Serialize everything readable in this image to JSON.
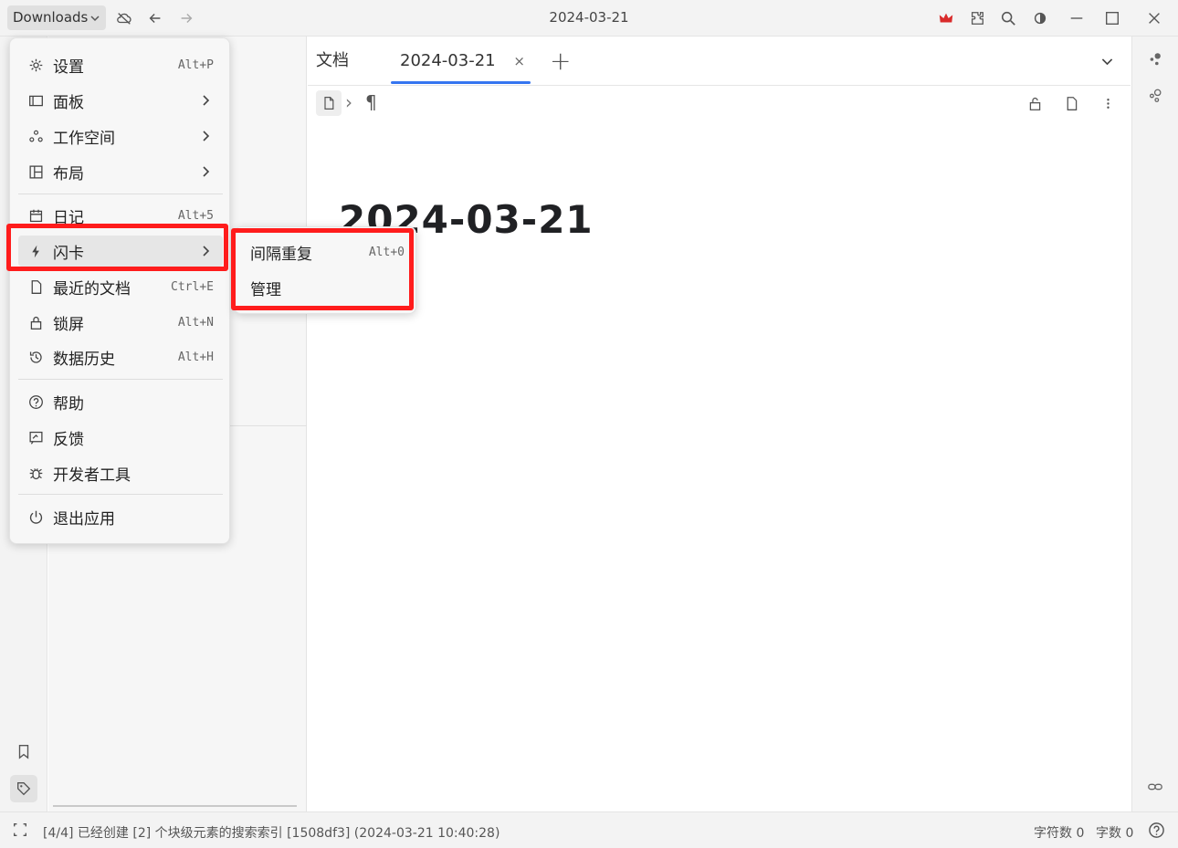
{
  "topbar": {
    "workspace": "Downloads",
    "window_title": "2024-03-21",
    "crown_color": "#d92b2b"
  },
  "editor": {
    "tabs": [
      {
        "label": "文档"
      },
      {
        "label": "2024-03-21",
        "close": "×"
      }
    ],
    "add_tab": "+",
    "crumb_sep": "›",
    "crumb_para": "¶",
    "doc_title": "2024-03-21"
  },
  "menu": {
    "items": [
      {
        "label": "设置",
        "kb": "Alt+P"
      },
      {
        "label": "面板"
      },
      {
        "label": "工作空间"
      },
      {
        "label": "布局"
      },
      {
        "label": "日记",
        "kb": "Alt+5"
      },
      {
        "label": "闪卡"
      },
      {
        "label": "最近的文档",
        "kb": "Ctrl+E"
      },
      {
        "label": "锁屏",
        "kb": "Alt+N"
      },
      {
        "label": "数据历史",
        "kb": "Alt+H"
      },
      {
        "label": "帮助"
      },
      {
        "label": "反馈"
      },
      {
        "label": "开发者工具"
      },
      {
        "label": "退出应用"
      }
    ]
  },
  "submenu": {
    "items": [
      {
        "label": "间隔重复",
        "kb": "Alt+0"
      },
      {
        "label": "管理"
      }
    ]
  },
  "statusbar": {
    "message": "[4/4] 已经创建 [2] 个块级元素的搜索索引 [1508df3] (2024-03-21 10:40:28)",
    "char_count": "字符数 0",
    "word_count": "字数 0"
  },
  "highlight_color": "#ff1c1c",
  "accent_color": "#3575f0"
}
